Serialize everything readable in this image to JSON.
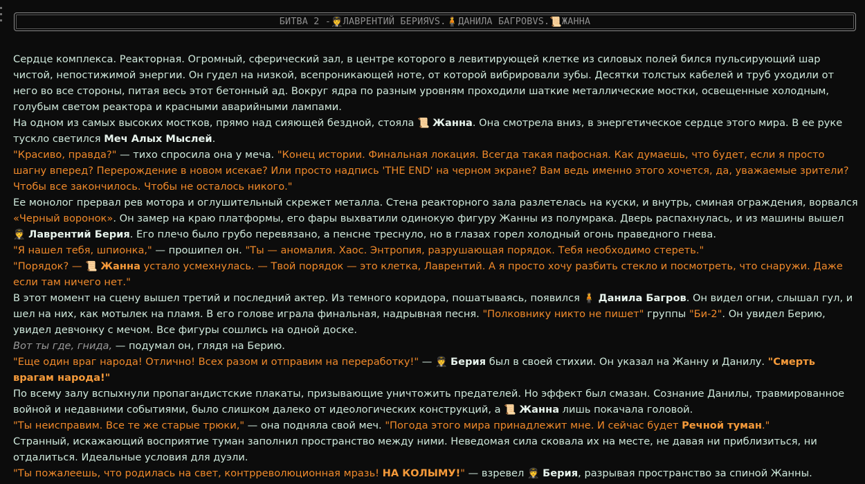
{
  "banner": {
    "prefix": "БИТВА 2 - ",
    "f1": "ЛАВРЕНТИЙ БЕРИЯ",
    "vs1": " VS. ",
    "f2": "ДАНИЛА БАГРОВ",
    "vs2": " VS. ",
    "f3": "ЖАННА"
  },
  "icons": {
    "beria": "🧑‍✈️",
    "danila": "🧍",
    "zhanna": "📜"
  },
  "text": {
    "p1": "Сердце комплекса. Реакторная. Огромный, сферический зал, в центре которого в левитирующей клетке из силовых полей бился пульсирующий шар чистой, непостижимой энергии. Он гудел на низкой, всепроникающей ноте, от которой вибрировали зубы. Десятки толстых кабелей и труб уходили от него во все стороны, питая весь этот бетонный ад. Вокруг ядра по разным уровням проходили шаткие металлические мостки, освещенные холодным, голубым светом реактора и красными аварийными лампами.",
    "p2a": "На одном из самых высоких мостков, прямо над сияющей бездной, стояла ",
    "p2_name": "Жанна",
    "p2b": ". Она смотрела вниз, в энергетическое сердце этого мира. В ее руке тускло светился ",
    "p2_sword": "Меч Алых Мыслей",
    "p2c": ".",
    "p3a": "\"Красиво, правда?\"",
    "p3b": " — тихо спросила она у меча. ",
    "p3c": "\"Конец истории. Финальная локация. Всегда такая пафосная. Как думаешь, что будет, если я просто шагну вперед? Перерождение в новом исекае? Или просто надпись 'THE END' на черном экране? Вам ведь именно этого хочется, да, уважаемые зрители? Чтобы все закончилось. Чтобы не осталось никого.\"",
    "p4a": "Ее монолог прервал рев мотора и оглушительный скрежет металла. Стена реакторного зала разлетелась на куски, и внутрь, сминая ограждения, ворвался ",
    "p4_car": "«Черный воронок»",
    "p4b": ". Он замер на краю платформы, его фары выхватили одинокую фигуру Жанны из полумрака. Дверь распахнулась, и из машины вышел ",
    "p4_name": "Лаврентий Берия",
    "p4c": ". Его плечо было грубо перевязано, а пенсне треснуло, но в глазах горел холодный огонь праведного гнева.",
    "p5a": "\"Я нашел тебя, шпионка,\"",
    "p5b": " — прошипел он. ",
    "p5c": "\"Ты — аномалия. Хаос. Энтропия, разрушающая порядок. Тебя необходимо стереть.\"",
    "p6a": "\"Порядок? — ",
    "p6_name": "Жанна",
    "p6b": " устало усмехнулась. — Твой порядок — это клетка, Лаврентий. А я просто хочу разбить стекло и посмотреть, что снаружи. Даже если там ничего нет.\"",
    "p7a": "В этот момент на сцену вышел третий и последний актер. Из темного коридора, пошатываясь, появился ",
    "p7_name": "Данила Багров",
    "p7b": ". Он видел огни, слышал гул, и шел на них, как мотылек на пламя. В его голове играла финальная, надрывная песня. ",
    "p7_song": "\"Полковнику никто не пишет\"",
    "p7c": " группы ",
    "p7_band": "\"Би-2\"",
    "p7d": ". Он увидел Берию, увидел девчонку с мечом. Все фигуры сошлись на одной доске.",
    "p8a": "Вот ты где, гнида,",
    "p8b": " — подумал он, глядя на Берию.",
    "p9a": "\"Еще один враг народа! Отлично! Всех разом и отправим на переработку!\"",
    "p9b": " — ",
    "p9_name": "Берия",
    "p9c": " был в своей стихии. Он указал на Жанну и Данилу. ",
    "p9_shout": "\"Смерть врагам народа!\"",
    "p10a": "По всему залу вспыхнули пропагандистские плакаты, призывающие уничтожить предателей. Но эффект был смазан. Сознание Данилы, травмированное войной и недавними событиями, было слишком далеко от идеологических конструкций, а ",
    "p10_name": "Жанна",
    "p10b": " лишь покачала головой.",
    "p11a": "\"Ты неисправим. Все те же старые трюки,\"",
    "p11b": " — она подняла свой меч. ",
    "p11c": "\"Погода этого мира принадлежит мне. И сейчас будет ",
    "p11_spell": "Речной туман",
    "p11d": ".\"",
    "p12": "Странный, искажающий восприятие туман заполнил пространство между ними. Неведомая сила сковала их на месте, не давая ни приблизиться, ни отдалиться. Идеальные условия для дуэли.",
    "p13a": "\"Ты пожалеешь, что родилась на свет, контрреволюционная мразь! ",
    "p13_shout": "НА КОЛЫМУ!",
    "p13b": "\"",
    "p13c": " — взревел ",
    "p13_name": "Берия",
    "p13d": ", разрывая пространство за спиной Жанны."
  }
}
